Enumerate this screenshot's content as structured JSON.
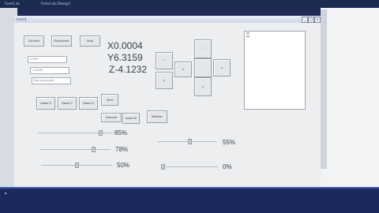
{
  "topbar": {
    "tabs": [
      "Form1.vb",
      "Form1.vb [Design]"
    ]
  },
  "window": {
    "title": "Form1",
    "minimize": "_",
    "maximize": "□",
    "close": "x"
  },
  "buttons": {
    "connect": "Connect",
    "disconnect": "Disconnect",
    "stop": "Stop",
    "home_x": "Home X",
    "home_y": "Home Y",
    "home_z": "Home Z",
    "zero": "Zero",
    "execute": "Execute",
    "load_gcode": "Load GC",
    "refresh": "Refresh"
  },
  "fields": {
    "field1": "COM3",
    "field2": "115200",
    "field3": "Not connected"
  },
  "coords": {
    "x": "X0.0004",
    "y": "Y6.3159",
    "z": "Z-4.1232"
  },
  "jog": {
    "z_up": "^",
    "z_down": "v",
    "y_up": "^",
    "y_down": "v",
    "x_left": "<",
    "x_right": ">"
  },
  "list": {
    "items": [
      "ok",
      "ok"
    ]
  },
  "sliders": {
    "s1": {
      "label": "85%",
      "value": 0.85
    },
    "s2": {
      "label": "78%",
      "value": 0.78
    },
    "s3": {
      "label": "50%",
      "value": 0.5
    },
    "s4": {
      "label": "55%",
      "value": 0.55
    },
    "s5": {
      "label": "0%",
      "value": 0.0
    }
  },
  "colors": {
    "taskbar": "#1b2a5a",
    "client": "#eceeef"
  }
}
